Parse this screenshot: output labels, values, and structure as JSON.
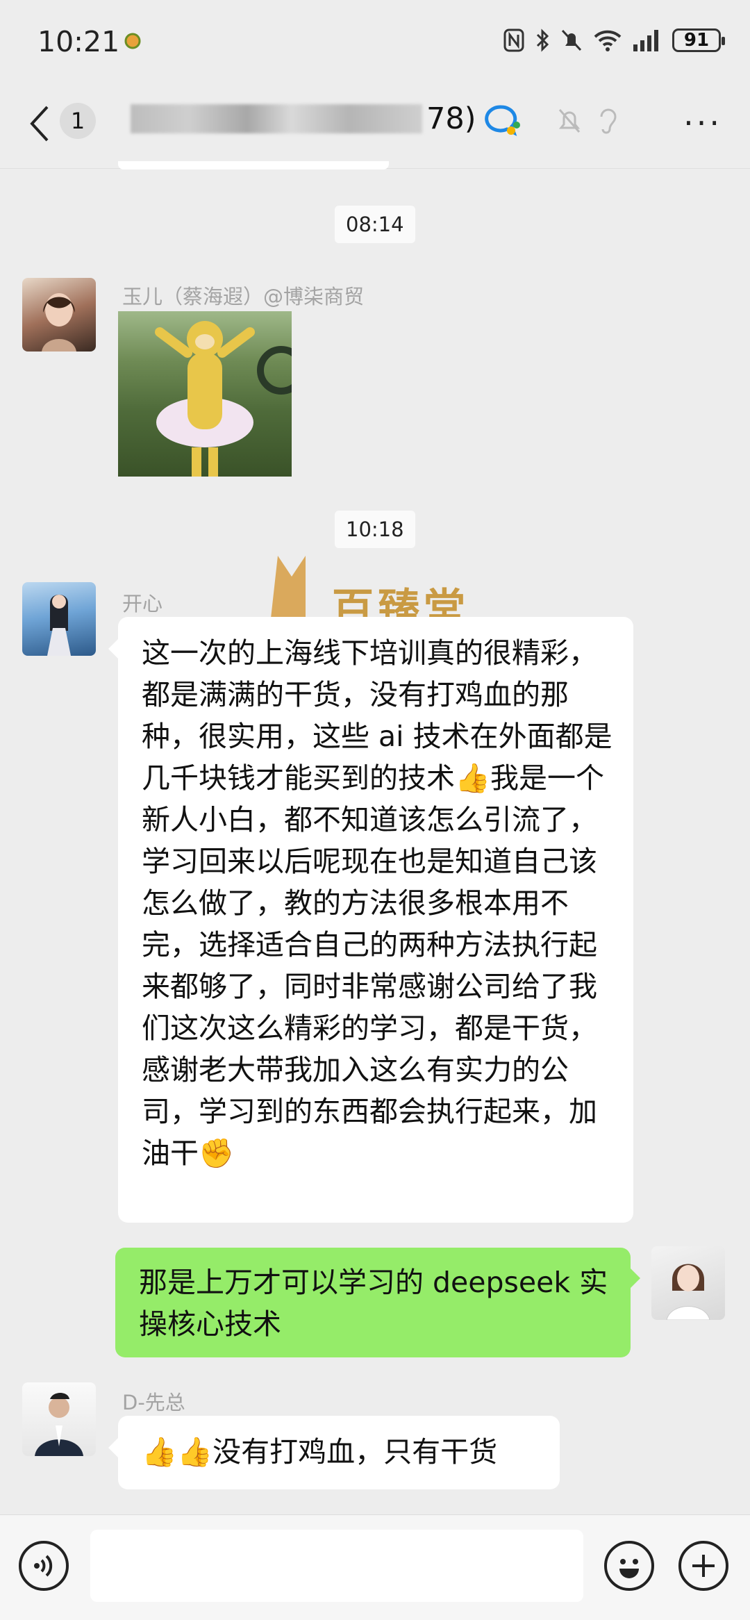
{
  "status_bar": {
    "time": "10:21",
    "battery": "91"
  },
  "nav": {
    "unread_count": "1",
    "title_visible_suffix": "78)",
    "more_label": "···"
  },
  "messages": [
    {
      "timestamp": "08:14"
    },
    {
      "sender": "玉儿（蔡海遐）@博柒商贸",
      "content_type": "sticker"
    },
    {
      "timestamp": "10:18"
    },
    {
      "sender": "开心",
      "text": "这一次的上海线下培训真的很精彩，都是满满的干货，没有打鸡血的那种，很实用，这些 ai 技术在外面都是几千块钱才能买到的技术👍我是一个新人小白，都不知道该怎么引流了，学习回来以后呢现在也是知道自己该怎么做了，教的方法很多根本用不完，选择适合自己的两种方法执行起来都够了，同时非常感谢公司给了我们这次这么精彩的学习，都是干货，感谢老大带我加入这么有实力的公司，学习到的东西都会执行起来，加油干✊"
    },
    {
      "sender": "self",
      "text": "那是上万才可以学习的 deepseek 实操核心技术"
    },
    {
      "sender": "D-先总",
      "text": "👍👍没有打鸡血，只有干货"
    }
  ],
  "watermark_text": "百臻堂",
  "colors": {
    "background": "#ededed",
    "self_bubble": "#95ec69",
    "other_bubble": "#ffffff",
    "sender_name": "#a3a3a3"
  },
  "icons": [
    "back-arrow-icon",
    "group-chat-icon",
    "mute-bell-icon",
    "hearing-icon",
    "voice-icon",
    "emoji-icon",
    "plus-icon"
  ]
}
